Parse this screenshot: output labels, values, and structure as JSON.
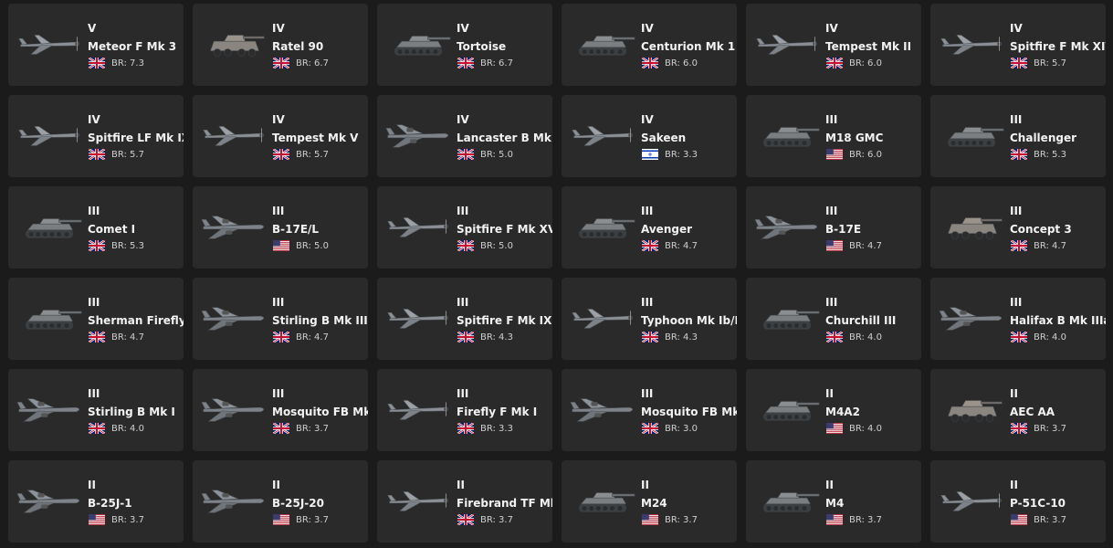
{
  "vehicles": [
    {
      "tier": "V",
      "name": "Meteor F Mk 3",
      "flag": "uk",
      "br": "BR: 7.3",
      "type": "plane",
      "icon": "jet-plane-icon"
    },
    {
      "tier": "IV",
      "name": "Ratel 90",
      "flag": "uk",
      "br": "BR: 6.7",
      "type": "wheeled",
      "icon": "armored-car-icon"
    },
    {
      "tier": "IV",
      "name": "Tortoise",
      "flag": "uk",
      "br": "BR: 6.7",
      "type": "tank",
      "icon": "tank-destroyer-icon"
    },
    {
      "tier": "IV",
      "name": "Centurion Mk 1",
      "flag": "uk",
      "br": "BR: 6.0",
      "type": "tank",
      "icon": "tank-icon"
    },
    {
      "tier": "IV",
      "name": "Tempest Mk II",
      "flag": "uk",
      "br": "BR: 6.0",
      "type": "plane",
      "icon": "fighter-plane-icon"
    },
    {
      "tier": "IV",
      "name": "Spitfire F Mk XIVe",
      "flag": "uk",
      "br": "BR: 5.7",
      "type": "plane",
      "icon": "fighter-plane-icon"
    },
    {
      "tier": "IV",
      "name": "Spitfire LF Mk IX",
      "flag": "uk",
      "br": "BR: 5.7",
      "type": "plane",
      "icon": "fighter-plane-icon"
    },
    {
      "tier": "IV",
      "name": "Tempest Mk V",
      "flag": "uk",
      "br": "BR: 5.7",
      "type": "plane",
      "icon": "fighter-plane-icon"
    },
    {
      "tier": "IV",
      "name": "Lancaster B Mk I",
      "flag": "uk",
      "br": "BR: 5.0",
      "type": "bomber",
      "icon": "bomber-plane-icon"
    },
    {
      "tier": "IV",
      "name": "Sakeen",
      "flag": "il",
      "br": "BR: 3.3",
      "type": "plane",
      "icon": "fighter-plane-icon"
    },
    {
      "tier": "III",
      "name": "M18 GMC",
      "flag": "us",
      "br": "BR: 6.0",
      "type": "tank",
      "icon": "tank-icon"
    },
    {
      "tier": "III",
      "name": "Challenger",
      "flag": "uk",
      "br": "BR: 5.3",
      "type": "tank",
      "icon": "tank-icon"
    },
    {
      "tier": "III",
      "name": "Comet I",
      "flag": "uk",
      "br": "BR: 5.3",
      "type": "tank",
      "icon": "tank-icon"
    },
    {
      "tier": "III",
      "name": "B-17E/L",
      "flag": "us",
      "br": "BR: 5.0",
      "type": "bomber",
      "icon": "bomber-plane-icon"
    },
    {
      "tier": "III",
      "name": "Spitfire F Mk XVI",
      "flag": "uk",
      "br": "BR: 5.0",
      "type": "plane",
      "icon": "fighter-plane-icon"
    },
    {
      "tier": "III",
      "name": "Avenger",
      "flag": "uk",
      "br": "BR: 4.7",
      "type": "tank",
      "icon": "tank-icon"
    },
    {
      "tier": "III",
      "name": "B-17E",
      "flag": "us",
      "br": "BR: 4.7",
      "type": "bomber",
      "icon": "bomber-plane-icon"
    },
    {
      "tier": "III",
      "name": "Concept 3",
      "flag": "uk",
      "br": "BR: 4.7",
      "type": "wheeled",
      "icon": "armored-car-icon"
    },
    {
      "tier": "III",
      "name": "Sherman Firefly",
      "flag": "uk",
      "br": "BR: 4.7",
      "type": "tank",
      "icon": "tank-icon"
    },
    {
      "tier": "III",
      "name": "Stirling B Mk III",
      "flag": "uk",
      "br": "BR: 4.7",
      "type": "bomber",
      "icon": "bomber-plane-icon"
    },
    {
      "tier": "III",
      "name": "Spitfire F Mk IX",
      "flag": "uk",
      "br": "BR: 4.3",
      "type": "plane",
      "icon": "fighter-plane-icon"
    },
    {
      "tier": "III",
      "name": "Typhoon Mk Ib/L",
      "flag": "uk",
      "br": "BR: 4.3",
      "type": "plane",
      "icon": "fighter-plane-icon"
    },
    {
      "tier": "III",
      "name": "Churchill III",
      "flag": "uk",
      "br": "BR: 4.0",
      "type": "tank",
      "icon": "tank-icon"
    },
    {
      "tier": "III",
      "name": "Halifax B Mk IIIa",
      "flag": "uk",
      "br": "BR: 4.0",
      "type": "bomber",
      "icon": "bomber-plane-icon"
    },
    {
      "tier": "III",
      "name": "Stirling B Mk I",
      "flag": "uk",
      "br": "BR: 4.0",
      "type": "bomber",
      "icon": "bomber-plane-icon"
    },
    {
      "tier": "III",
      "name": "Mosquito FB Mk V",
      "flag": "uk",
      "br": "BR: 3.7",
      "type": "bomber",
      "icon": "twin-engine-plane-icon"
    },
    {
      "tier": "III",
      "name": "Firefly F Mk I",
      "flag": "uk",
      "br": "BR: 3.3",
      "type": "plane",
      "icon": "fighter-plane-icon"
    },
    {
      "tier": "III",
      "name": "Mosquito FB Mk X",
      "flag": "uk",
      "br": "BR: 3.0",
      "type": "bomber",
      "icon": "twin-engine-plane-icon"
    },
    {
      "tier": "II",
      "name": "M4A2",
      "flag": "us",
      "br": "BR: 4.0",
      "type": "tank",
      "icon": "tank-icon"
    },
    {
      "tier": "II",
      "name": "AEC AA",
      "flag": "uk",
      "br": "BR: 3.7",
      "type": "wheeled",
      "icon": "armored-car-icon"
    },
    {
      "tier": "II",
      "name": "B-25J-1",
      "flag": "us",
      "br": "BR: 3.7",
      "type": "bomber",
      "icon": "bomber-plane-icon"
    },
    {
      "tier": "II",
      "name": "B-25J-20",
      "flag": "us",
      "br": "BR: 3.7",
      "type": "bomber",
      "icon": "bomber-plane-icon"
    },
    {
      "tier": "II",
      "name": "Firebrand TF Mk IV",
      "flag": "uk",
      "br": "BR: 3.7",
      "type": "plane",
      "icon": "fighter-plane-icon"
    },
    {
      "tier": "II",
      "name": "M24",
      "flag": "us",
      "br": "BR: 3.7",
      "type": "tank",
      "icon": "tank-icon"
    },
    {
      "tier": "II",
      "name": "M4",
      "flag": "us",
      "br": "BR: 3.7",
      "type": "tank",
      "icon": "tank-icon"
    },
    {
      "tier": "II",
      "name": "P-51C-10",
      "flag": "us",
      "br": "BR: 3.7",
      "type": "plane",
      "icon": "fighter-plane-icon"
    }
  ],
  "colors": {
    "background": "#1b1b1b",
    "card": "#2a2a2a",
    "text": "#f2f2f2",
    "br_text": "#cfcfcf"
  }
}
